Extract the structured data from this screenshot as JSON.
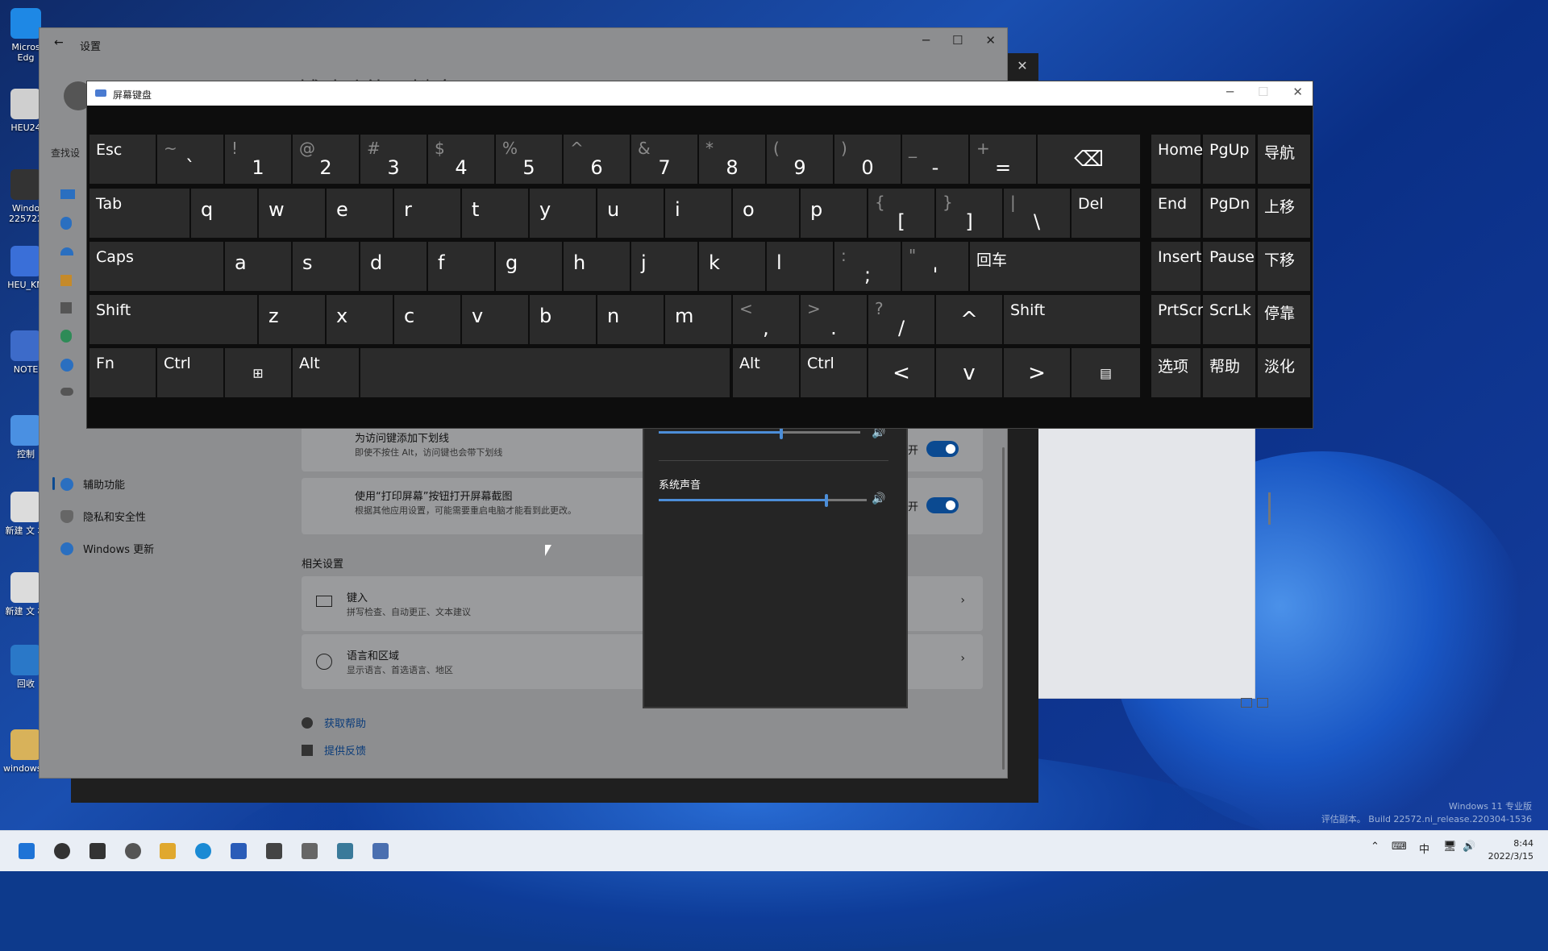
{
  "desktop": {
    "icons": [
      {
        "label": "Micros Edg",
        "icon": "edge-icon"
      },
      {
        "label": "HEU24",
        "icon": "file-icon"
      },
      {
        "label": "Windo 225722",
        "icon": "video-icon"
      },
      {
        "label": "HEU_KM",
        "icon": "box-icon"
      },
      {
        "label": "NOTE",
        "icon": "gear-icon"
      },
      {
        "label": "控制",
        "icon": "control-panel-icon"
      },
      {
        "label": "新建 文 本",
        "icon": "text-file-icon"
      },
      {
        "label": "新建 文 档",
        "icon": "text-file-icon"
      },
      {
        "label": "回收",
        "icon": "recycle-bin-icon"
      },
      {
        "label": "windows...",
        "icon": "folder-icon"
      }
    ],
    "watermark": {
      "line1": "Windows 11 专业版",
      "line2": "评估副本。 Build 22572.ni_release.220304-1536"
    }
  },
  "settings": {
    "title": "设置",
    "page_title": "辅助功能 › 键盘",
    "search_placeholder": "查找设",
    "nav": [
      {
        "label": "辅助功能",
        "icon": "accessibility-icon"
      },
      {
        "label": "隐私和安全性",
        "icon": "shield-icon"
      },
      {
        "label": "Windows 更新",
        "icon": "update-icon"
      }
    ],
    "rows": [
      {
        "title": "为访问键添加下划线",
        "subtitle": "即使不按住 Alt，访问键也会带下划线",
        "toggle_label": "开"
      },
      {
        "title": "使用“打印屏幕”按钮打开屏幕截图",
        "subtitle": "根据其他应用设置，可能需要重启电脑才能看到此更改。",
        "toggle_label": "开"
      }
    ],
    "related_heading": "相关设置",
    "related": [
      {
        "title": "键入",
        "subtitle": "拼写检查、自动更正、文本建议",
        "icon": "keyboard-icon"
      },
      {
        "title": "语言和区域",
        "subtitle": "显示语言、首选语言、地区",
        "icon": "language-icon"
      }
    ],
    "links": [
      {
        "label": "获取帮助",
        "icon": "help-icon"
      },
      {
        "label": "提供反馈",
        "icon": "feedback-icon"
      }
    ]
  },
  "volume": {
    "system_sound_label": "系统声音",
    "system_sound_level": 0.8,
    "top_level": 0.6
  },
  "osk": {
    "title": "屏幕键盘",
    "rows": [
      [
        {
          "main": "Esc"
        },
        {
          "top": "~",
          "bot": "`"
        },
        {
          "top": "!",
          "bot": "1"
        },
        {
          "top": "@",
          "bot": "2"
        },
        {
          "top": "#",
          "bot": "3"
        },
        {
          "top": "$",
          "bot": "4"
        },
        {
          "top": "%",
          "bot": "5"
        },
        {
          "top": "^",
          "bot": "6"
        },
        {
          "top": "&",
          "bot": "7"
        },
        {
          "top": "*",
          "bot": "8"
        },
        {
          "top": "(",
          "bot": "9"
        },
        {
          "top": ")",
          "bot": "0"
        },
        {
          "top": "_",
          "bot": "-"
        },
        {
          "top": "+",
          "bot": "="
        },
        {
          "main": "⌫"
        },
        {
          "main": "Home"
        },
        {
          "main": "PgUp"
        },
        {
          "main": "导航"
        }
      ],
      [
        {
          "main": "Tab"
        },
        {
          "ltr": "q"
        },
        {
          "ltr": "w"
        },
        {
          "ltr": "e"
        },
        {
          "ltr": "r"
        },
        {
          "ltr": "t"
        },
        {
          "ltr": "y"
        },
        {
          "ltr": "u"
        },
        {
          "ltr": "i"
        },
        {
          "ltr": "o"
        },
        {
          "ltr": "p"
        },
        {
          "top": "{",
          "bot": "["
        },
        {
          "top": "}",
          "bot": "]"
        },
        {
          "top": "|",
          "bot": "\\"
        },
        {
          "main": "Del"
        },
        {
          "main": "End"
        },
        {
          "main": "PgDn"
        },
        {
          "main": "上移"
        }
      ],
      [
        {
          "main": "Caps"
        },
        {
          "ltr": "a"
        },
        {
          "ltr": "s"
        },
        {
          "ltr": "d"
        },
        {
          "ltr": "f"
        },
        {
          "ltr": "g"
        },
        {
          "ltr": "h"
        },
        {
          "ltr": "j"
        },
        {
          "ltr": "k"
        },
        {
          "ltr": "l"
        },
        {
          "top": ":",
          "bot": ";"
        },
        {
          "top": "\"",
          "bot": "'"
        },
        {
          "main": "回车"
        },
        {
          "main": "Insert"
        },
        {
          "main": "Pause"
        },
        {
          "main": "下移"
        }
      ],
      [
        {
          "main": "Shift"
        },
        {
          "ltr": "z"
        },
        {
          "ltr": "x"
        },
        {
          "ltr": "c"
        },
        {
          "ltr": "v"
        },
        {
          "ltr": "b"
        },
        {
          "ltr": "n"
        },
        {
          "ltr": "m"
        },
        {
          "top": "<",
          "bot": ","
        },
        {
          "top": ">",
          "bot": "."
        },
        {
          "top": "?",
          "bot": "/"
        },
        {
          "main": "^"
        },
        {
          "main": "Shift"
        },
        {
          "main": "PrtScn"
        },
        {
          "main": "ScrLk"
        },
        {
          "main": "停靠"
        }
      ],
      [
        {
          "main": "Fn"
        },
        {
          "main": "Ctrl"
        },
        {
          "main": "⊞"
        },
        {
          "main": "Alt"
        },
        {
          "main": ""
        },
        {
          "main": "Alt"
        },
        {
          "main": "Ctrl"
        },
        {
          "main": "<"
        },
        {
          "main": "v"
        },
        {
          "main": ">"
        },
        {
          "main": "▤"
        },
        {
          "main": "选项"
        },
        {
          "main": "帮助"
        },
        {
          "main": "淡化"
        }
      ]
    ]
  },
  "taskbar": {
    "time": "8:44",
    "date": "2022/3/15",
    "ime": "中",
    "apps": [
      "start-icon",
      "search-icon",
      "taskview-icon",
      "edge-dev-icon",
      "explorer-icon",
      "edge-icon",
      "store-icon",
      "camera-icon",
      "settings-icon",
      "monitor-icon",
      "keyboard-icon"
    ]
  }
}
